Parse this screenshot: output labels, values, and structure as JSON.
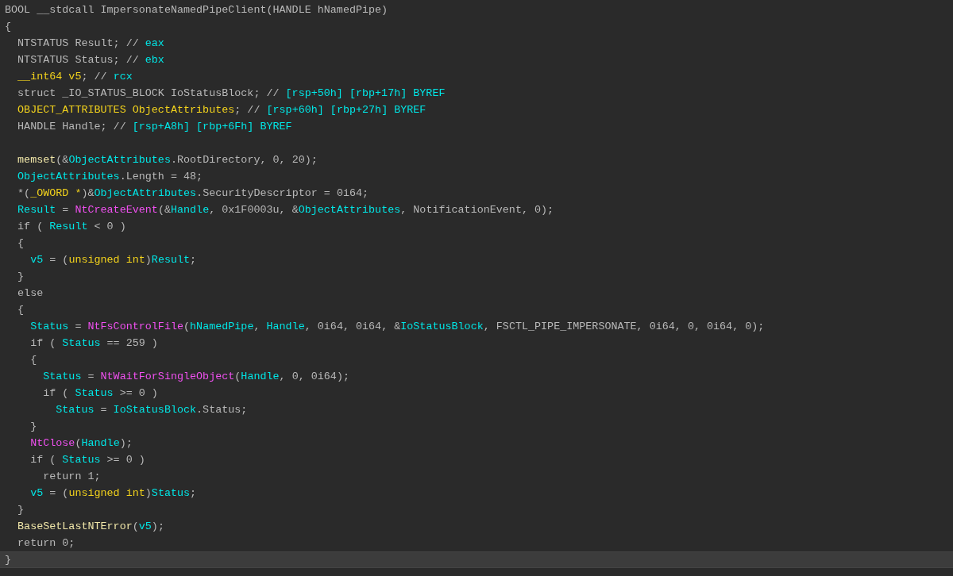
{
  "lines": [
    {
      "selected": false,
      "tokens": [
        {
          "kind": "plain",
          "text": "BOOL __stdcall ImpersonateNamedPipeClient(HANDLE hNamedPipe)"
        }
      ]
    },
    {
      "selected": false,
      "tokens": [
        {
          "kind": "plain",
          "text": "{"
        }
      ]
    },
    {
      "selected": false,
      "tokens": [
        {
          "kind": "plain",
          "text": "  NTSTATUS Result; // "
        },
        {
          "kind": "var",
          "text": "eax"
        }
      ]
    },
    {
      "selected": false,
      "tokens": [
        {
          "kind": "plain",
          "text": "  NTSTATUS Status; // "
        },
        {
          "kind": "var",
          "text": "ebx"
        }
      ]
    },
    {
      "selected": false,
      "tokens": [
        {
          "kind": "type",
          "text": "  __int64 v5"
        },
        {
          "kind": "plain",
          "text": "; // "
        },
        {
          "kind": "var",
          "text": "rcx"
        }
      ]
    },
    {
      "selected": false,
      "tokens": [
        {
          "kind": "plain",
          "text": "  struct _IO_STATUS_BLOCK IoStatusBlock; // "
        },
        {
          "kind": "var",
          "text": "[rsp+50h] [rbp+17h] BYREF"
        }
      ]
    },
    {
      "selected": false,
      "tokens": [
        {
          "kind": "type",
          "text": "  OBJECT_ATTRIBUTES ObjectAttributes"
        },
        {
          "kind": "plain",
          "text": "; // "
        },
        {
          "kind": "var",
          "text": "[rsp+60h] [rbp+27h] BYREF"
        }
      ]
    },
    {
      "selected": false,
      "tokens": [
        {
          "kind": "plain",
          "text": "  HANDLE Handle; // "
        },
        {
          "kind": "var",
          "text": "[rsp+A8h] [rbp+6Fh] BYREF"
        }
      ]
    },
    {
      "selected": false
    },
    {
      "selected": false,
      "tokens": [
        {
          "kind": "lib",
          "text": "  memset"
        },
        {
          "kind": "plain",
          "text": "(&"
        },
        {
          "kind": "var",
          "text": "ObjectAttributes"
        },
        {
          "kind": "plain",
          "text": ".RootDirectory, 0, 20);"
        }
      ]
    },
    {
      "selected": false,
      "tokens": [
        {
          "kind": "var",
          "text": "  ObjectAttributes"
        },
        {
          "kind": "plain",
          "text": ".Length = 48;"
        }
      ]
    },
    {
      "selected": false,
      "tokens": [
        {
          "kind": "plain",
          "text": "  *("
        },
        {
          "kind": "type",
          "text": "_OWORD *"
        },
        {
          "kind": "plain",
          "text": ")&"
        },
        {
          "kind": "var",
          "text": "ObjectAttributes"
        },
        {
          "kind": "plain",
          "text": ".SecurityDescriptor = 0i64;"
        }
      ]
    },
    {
      "selected": false,
      "tokens": [
        {
          "kind": "var",
          "text": "  Result"
        },
        {
          "kind": "plain",
          "text": " = "
        },
        {
          "kind": "func",
          "text": "NtCreateEvent"
        },
        {
          "kind": "plain",
          "text": "(&"
        },
        {
          "kind": "var",
          "text": "Handle"
        },
        {
          "kind": "plain",
          "text": ", 0x1F0003u, &"
        },
        {
          "kind": "var",
          "text": "ObjectAttributes"
        },
        {
          "kind": "plain",
          "text": ", NotificationEvent, 0);"
        }
      ]
    },
    {
      "selected": false,
      "tokens": [
        {
          "kind": "plain",
          "text": "  if ( "
        },
        {
          "kind": "var",
          "text": "Result"
        },
        {
          "kind": "plain",
          "text": " < 0 )"
        }
      ]
    },
    {
      "selected": false,
      "tokens": [
        {
          "kind": "plain",
          "text": "  {"
        }
      ]
    },
    {
      "selected": false,
      "tokens": [
        {
          "kind": "var",
          "text": "    v5"
        },
        {
          "kind": "plain",
          "text": " = ("
        },
        {
          "kind": "type",
          "text": "unsigned int"
        },
        {
          "kind": "plain",
          "text": ")"
        },
        {
          "kind": "var",
          "text": "Result"
        },
        {
          "kind": "plain",
          "text": ";"
        }
      ]
    },
    {
      "selected": false,
      "tokens": [
        {
          "kind": "plain",
          "text": "  }"
        }
      ]
    },
    {
      "selected": false,
      "tokens": [
        {
          "kind": "plain",
          "text": "  else"
        }
      ]
    },
    {
      "selected": false,
      "tokens": [
        {
          "kind": "plain",
          "text": "  {"
        }
      ]
    },
    {
      "selected": false,
      "tokens": [
        {
          "kind": "var",
          "text": "    Status"
        },
        {
          "kind": "plain",
          "text": " = "
        },
        {
          "kind": "func",
          "text": "NtFsControlFile"
        },
        {
          "kind": "plain",
          "text": "("
        },
        {
          "kind": "var",
          "text": "hNamedPipe"
        },
        {
          "kind": "plain",
          "text": ", "
        },
        {
          "kind": "var",
          "text": "Handle"
        },
        {
          "kind": "plain",
          "text": ", 0i64, 0i64, &"
        },
        {
          "kind": "var",
          "text": "IoStatusBlock"
        },
        {
          "kind": "plain",
          "text": ", FSCTL_PIPE_IMPERSONATE, 0i64, 0, 0i64, 0);"
        }
      ]
    },
    {
      "selected": false,
      "tokens": [
        {
          "kind": "plain",
          "text": "    if ( "
        },
        {
          "kind": "var",
          "text": "Status"
        },
        {
          "kind": "plain",
          "text": " == 259 )"
        }
      ]
    },
    {
      "selected": false,
      "tokens": [
        {
          "kind": "plain",
          "text": "    {"
        }
      ]
    },
    {
      "selected": false,
      "tokens": [
        {
          "kind": "var",
          "text": "      Status"
        },
        {
          "kind": "plain",
          "text": " = "
        },
        {
          "kind": "func",
          "text": "NtWaitForSingleObject"
        },
        {
          "kind": "plain",
          "text": "("
        },
        {
          "kind": "var",
          "text": "Handle"
        },
        {
          "kind": "plain",
          "text": ", 0, 0i64);"
        }
      ]
    },
    {
      "selected": false,
      "tokens": [
        {
          "kind": "plain",
          "text": "      if ( "
        },
        {
          "kind": "var",
          "text": "Status"
        },
        {
          "kind": "plain",
          "text": " >= 0 )"
        }
      ]
    },
    {
      "selected": false,
      "tokens": [
        {
          "kind": "var",
          "text": "        Status"
        },
        {
          "kind": "plain",
          "text": " = "
        },
        {
          "kind": "var",
          "text": "IoStatusBlock"
        },
        {
          "kind": "plain",
          "text": ".Status;"
        }
      ]
    },
    {
      "selected": false,
      "tokens": [
        {
          "kind": "plain",
          "text": "    }"
        }
      ]
    },
    {
      "selected": false,
      "tokens": [
        {
          "kind": "func",
          "text": "    NtClose"
        },
        {
          "kind": "plain",
          "text": "("
        },
        {
          "kind": "var",
          "text": "Handle"
        },
        {
          "kind": "plain",
          "text": ");"
        }
      ]
    },
    {
      "selected": false,
      "tokens": [
        {
          "kind": "plain",
          "text": "    if ( "
        },
        {
          "kind": "var",
          "text": "Status"
        },
        {
          "kind": "plain",
          "text": " >= 0 )"
        }
      ]
    },
    {
      "selected": false,
      "tokens": [
        {
          "kind": "plain",
          "text": "      return 1;"
        }
      ]
    },
    {
      "selected": false,
      "tokens": [
        {
          "kind": "var",
          "text": "    v5"
        },
        {
          "kind": "plain",
          "text": " = ("
        },
        {
          "kind": "type",
          "text": "unsigned int"
        },
        {
          "kind": "plain",
          "text": ")"
        },
        {
          "kind": "var",
          "text": "Status"
        },
        {
          "kind": "plain",
          "text": ";"
        }
      ]
    },
    {
      "selected": false,
      "tokens": [
        {
          "kind": "plain",
          "text": "  }"
        }
      ]
    },
    {
      "selected": false,
      "tokens": [
        {
          "kind": "lib",
          "text": "  BaseSetLastNTError"
        },
        {
          "kind": "plain",
          "text": "("
        },
        {
          "kind": "var",
          "text": "v5"
        },
        {
          "kind": "plain",
          "text": ");"
        }
      ]
    },
    {
      "selected": false,
      "tokens": [
        {
          "kind": "plain",
          "text": "  return 0;"
        }
      ]
    },
    {
      "selected": true,
      "tokens": [
        {
          "kind": "plain",
          "text": "}"
        }
      ]
    }
  ]
}
